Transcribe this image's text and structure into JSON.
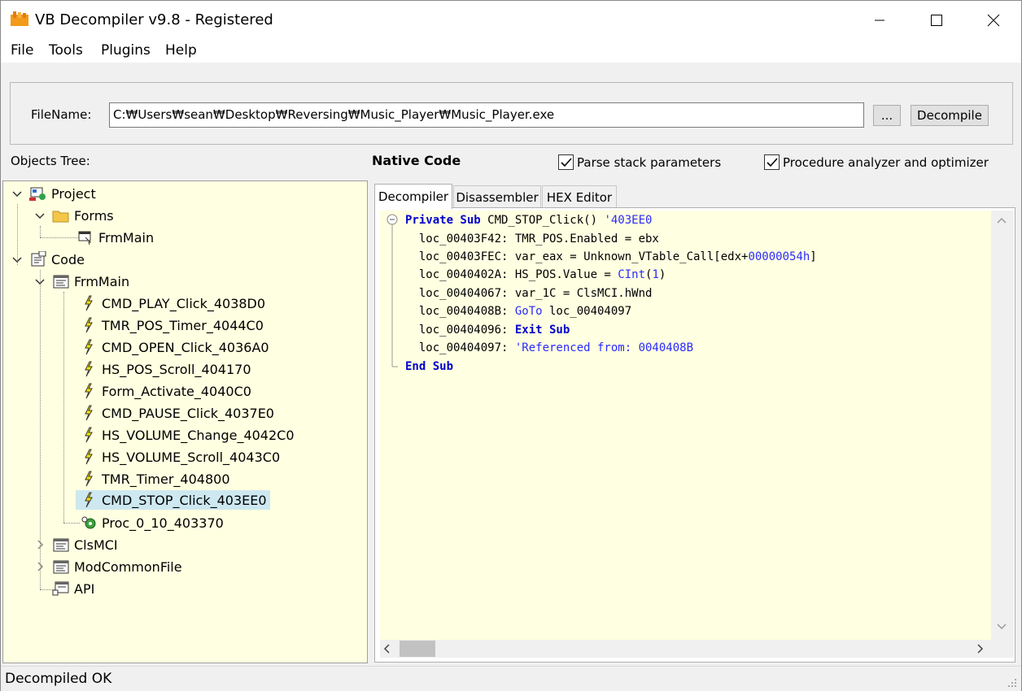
{
  "window": {
    "title": "VB Decompiler v9.8 - Registered"
  },
  "menu": {
    "items": [
      "File",
      "Tools",
      "Plugins",
      "Help"
    ]
  },
  "file": {
    "label": "FileName:",
    "path": "C:₩Users₩sean₩Desktop₩Reversing₩Music_Player₩Music_Player.exe",
    "browse_label": "...",
    "decompile_label": "Decompile"
  },
  "options": {
    "objects_tree_label": "Objects Tree:",
    "mode_label": "Native Code",
    "parse_stack": "Parse stack parameters",
    "optimizer": "Procedure analyzer and optimizer"
  },
  "tree": {
    "project": "Project",
    "forms": "Forms",
    "frmmain_form": "FrmMain",
    "code": "Code",
    "frmmain": "FrmMain",
    "procs": [
      "CMD_PLAY_Click_4038D0",
      "TMR_POS_Timer_4044C0",
      "CMD_OPEN_Click_4036A0",
      "HS_POS_Scroll_404170",
      "Form_Activate_4040C0",
      "CMD_PAUSE_Click_4037E0",
      "HS_VOLUME_Change_4042C0",
      "HS_VOLUME_Scroll_4043C0",
      "TMR_Timer_404800",
      "CMD_STOP_Click_403EE0"
    ],
    "proc_extra": "Proc_0_10_403370",
    "clsmci": "ClsMCI",
    "modcommon": "ModCommonFile",
    "api": "API"
  },
  "tabs": [
    "Decompiler",
    "Disassembler",
    "HEX Editor"
  ],
  "code": {
    "l0_kw": "Private Sub",
    "l0_rest": " CMD_STOP_Click() ",
    "l0_comment": "'403EE0",
    "l1": "  loc_00403F42: TMR_POS.Enabled = ebx",
    "l2a": "  loc_00403FEC: var_eax = Unknown_VTable_Call[edx+",
    "l2b": "00000054h",
    "l2c": "]",
    "l3a": "  loc_0040402A: HS_POS.Value = ",
    "l3b": "CInt",
    "l3c": "(",
    "l3d": "1",
    "l3e": ")",
    "l4": "  loc_00404067: var_1C = ClsMCI.hWnd",
    "l5a": "  loc_0040408B: ",
    "l5b": "GoTo",
    "l5c": " loc_00404097",
    "l6a": "  loc_00404096: ",
    "l6b": "Exit Sub",
    "l7a": "  loc_00404097: ",
    "l7b": "'Referenced from: 0040408B",
    "l8": "End Sub"
  },
  "status": {
    "text": "Decompiled OK"
  }
}
